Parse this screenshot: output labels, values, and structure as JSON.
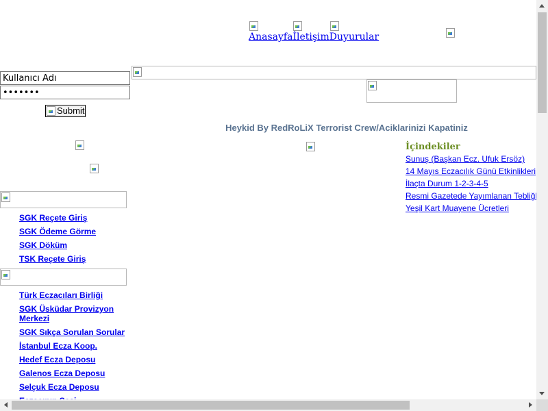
{
  "top_nav": [
    {
      "label": "Anasayfa"
    },
    {
      "label": "İletişim"
    },
    {
      "label": "Duyurular"
    }
  ],
  "login": {
    "username_value": "Kullanıcı Adı",
    "password_value": "•••••••",
    "submit_label": "Submit"
  },
  "main": {
    "heading": "Heykid By RedRoLiX Terrorist Crew/Aciklarinizi Kapatiniz"
  },
  "toc": {
    "title": "İçindekiler",
    "items": [
      {
        "label": "Sunuş (Başkan Ecz. Ufuk Ersöz)"
      },
      {
        "label": "14 Mayıs Eczacılık Günü Etkinlikleri"
      },
      {
        "label": "İlaçta Durum 1-2-3-4-5"
      },
      {
        "label": "Resmi Gazetede Yayımlanan Tebliğler"
      },
      {
        "label": "Yeşil Kart Muayene Ücretleri"
      }
    ]
  },
  "sidebar": {
    "group1": [
      {
        "label": "SGK Reçete Giriş"
      },
      {
        "label": "SGK Ödeme Görme"
      },
      {
        "label": "SGK Döküm"
      },
      {
        "label": "TSK Reçete Giriş"
      }
    ],
    "group2": [
      {
        "label": "Türk Eczacıları Birliği"
      },
      {
        "label": "SGK Üsküdar Provizyon Merkezi"
      },
      {
        "label": "SGK Sıkça Sorulan Sorular"
      },
      {
        "label": "İstanbul Ecza Koop."
      },
      {
        "label": "Hedef Ecza Deposu"
      },
      {
        "label": "Galenos Ecza Deposu"
      },
      {
        "label": "Selçuk Ecza Deposu"
      },
      {
        "label": "Eczacının Sesi"
      }
    ]
  }
}
